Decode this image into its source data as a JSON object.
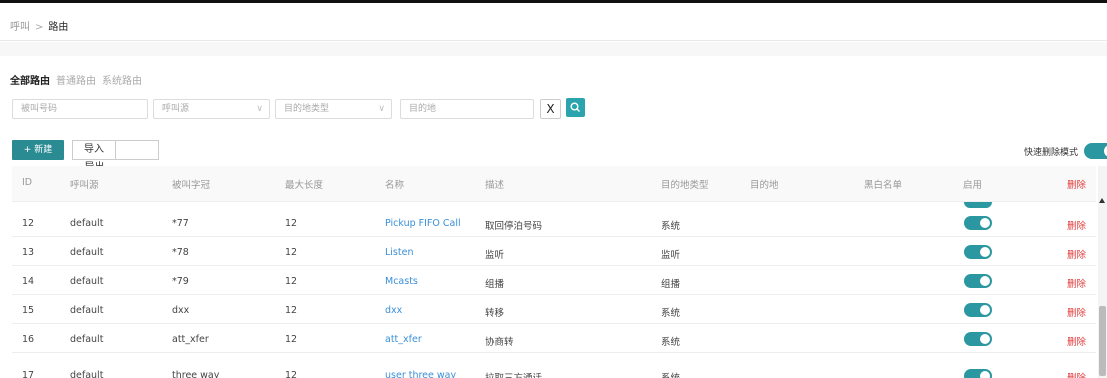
{
  "breadcrumb": {
    "parent": "呼叫",
    "separator": ">",
    "current": "路由"
  },
  "tabs": [
    {
      "label": "全部路由",
      "active": true
    },
    {
      "label": "普通路由",
      "active": false
    },
    {
      "label": "系统路由",
      "active": false
    }
  ],
  "filters": {
    "callee_placeholder": "被叫号码",
    "caller_source_placeholder": "呼叫源",
    "dest_type_placeholder": "目的地类型",
    "destination_placeholder": "目的地",
    "clear_label": "X"
  },
  "toolbar": {
    "new_label": "+ 新建",
    "import_label": "导入",
    "export_label": "导出",
    "quick_delete_label": "快速删除模式"
  },
  "table": {
    "columns": [
      "ID",
      "呼叫源",
      "被叫字冠",
      "最大长度",
      "名称",
      "描述",
      "目的地类型",
      "目的地",
      "黑白名单",
      "启用",
      "删除"
    ],
    "rows": [
      {
        "id": "12",
        "source": "default",
        "prefix": "*77",
        "max_len": "12",
        "name": "Pickup FIFO Call",
        "desc": "取回停泊号码",
        "dest_type": "系统",
        "dest": "",
        "list": "",
        "enabled": true,
        "del": "删除"
      },
      {
        "id": "13",
        "source": "default",
        "prefix": "*78",
        "max_len": "12",
        "name": "Listen",
        "desc": "监听",
        "dest_type": "监听",
        "dest": "",
        "list": "",
        "enabled": true,
        "del": "删除"
      },
      {
        "id": "14",
        "source": "default",
        "prefix": "*79",
        "max_len": "12",
        "name": "Mcasts",
        "desc": "组播",
        "dest_type": "组播",
        "dest": "",
        "list": "",
        "enabled": true,
        "del": "删除"
      },
      {
        "id": "15",
        "source": "default",
        "prefix": "dxx",
        "max_len": "12",
        "name": "dxx",
        "desc": "转移",
        "dest_type": "系统",
        "dest": "",
        "list": "",
        "enabled": true,
        "del": "删除"
      },
      {
        "id": "16",
        "source": "default",
        "prefix": "att_xfer",
        "max_len": "12",
        "name": "att_xfer",
        "desc": "协商转",
        "dest_type": "系统",
        "dest": "",
        "list": "",
        "enabled": true,
        "del": "删除"
      },
      {
        "id": "17",
        "source": "default",
        "prefix": "three way",
        "max_len": "12",
        "name": "user three way",
        "desc": "拉取三方通话",
        "dest_type": "系统",
        "dest": "",
        "list": "",
        "enabled": true,
        "del": "删除"
      }
    ]
  },
  "colors": {
    "accent": "#2b97a0",
    "delete": "#e03a3a",
    "link": "#3a8fd8"
  }
}
